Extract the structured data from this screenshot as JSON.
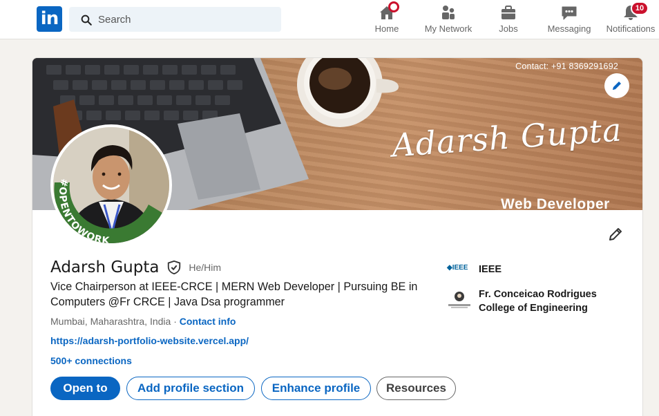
{
  "nav": {
    "logo_text": "in",
    "search_placeholder": "Search",
    "items": [
      {
        "label": "Home",
        "icon": "home-icon"
      },
      {
        "label": "My Network",
        "icon": "network-icon"
      },
      {
        "label": "Jobs",
        "icon": "briefcase-icon"
      },
      {
        "label": "Messaging",
        "icon": "chat-icon"
      },
      {
        "label": "Notifications",
        "icon": "bell-icon",
        "badge": "10"
      }
    ]
  },
  "banner": {
    "contact": "Contact: +91 8369291692",
    "script_name": "Adarsh Gupta",
    "subtitle": "Web Developer"
  },
  "avatar": {
    "ring_text": "#OPENTOWORK"
  },
  "profile": {
    "name": "Adarsh Gupta",
    "pronouns": "He/Him",
    "headline": "Vice Chairperson at IEEE-CRCE | MERN Web Developer | Pursuing BE in Computers @Fr CRCE | Java Dsa programmer",
    "location": "Mumbai, Maharashtra, India",
    "separator": " · ",
    "contact_info": "Contact info",
    "website": "https://adarsh-portfolio-website.vercel.app/",
    "connections": "500+ connections"
  },
  "organizations": [
    {
      "name": "IEEE",
      "logo_text": "◆IEEE"
    },
    {
      "name_line1": "Fr. Conceicao Rodrigues",
      "name_line2": "College of Engineering"
    }
  ],
  "actions": {
    "open_to": "Open to",
    "add_section": "Add profile section",
    "enhance": "Enhance profile",
    "resources": "Resources"
  },
  "colors": {
    "brand": "#0a66c2",
    "badge": "#cb112d",
    "open_to_work": "#3a7a32"
  }
}
